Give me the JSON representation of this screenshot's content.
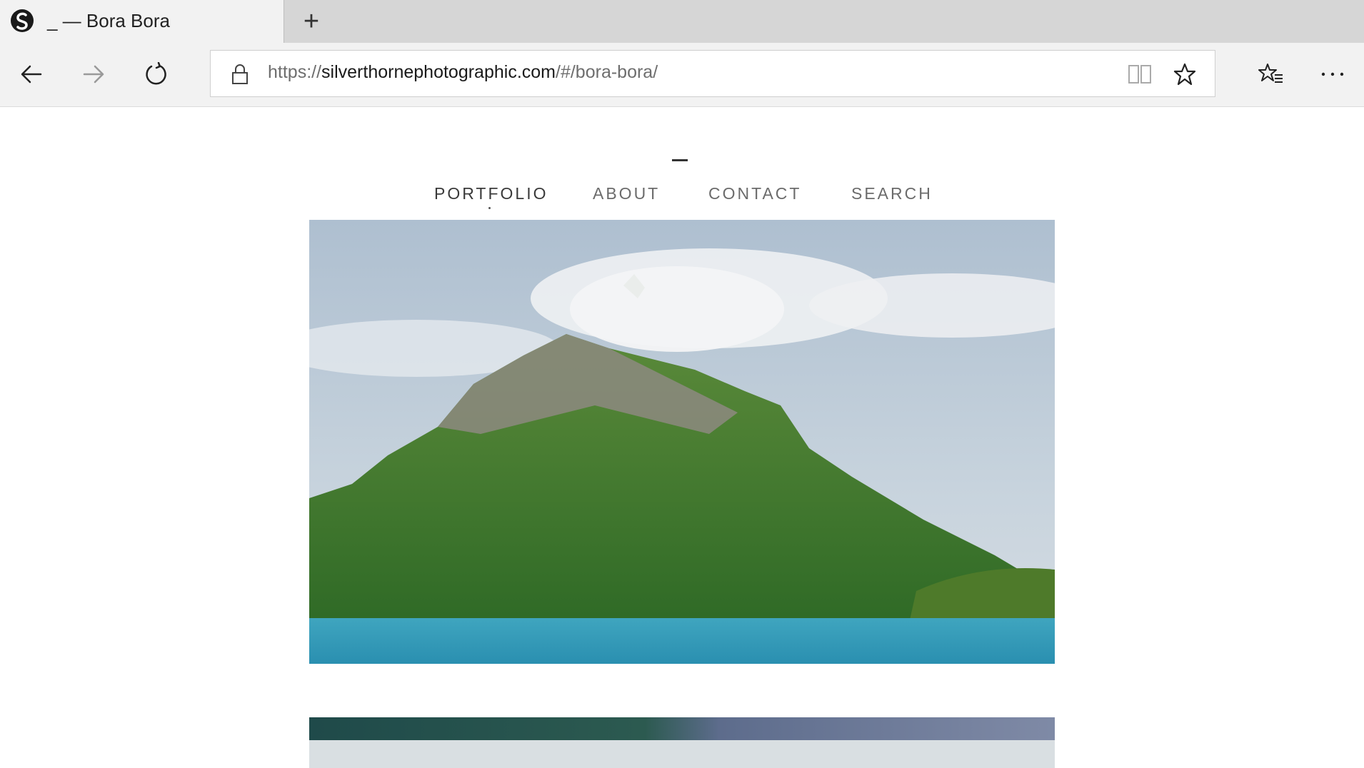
{
  "browser": {
    "tab_title": "_ — Bora Bora",
    "new_tab_label": "+",
    "url_scheme": "https://",
    "url_domain": "silverthornephotographic.com",
    "url_path": "/#/bora-bora/"
  },
  "site": {
    "nav": [
      {
        "label": "PORTFOLIO",
        "active": true
      },
      {
        "label": "ABOUT",
        "active": false
      },
      {
        "label": "CONTACT",
        "active": false
      },
      {
        "label": "SEARCH",
        "active": false
      }
    ]
  },
  "colors": {
    "tabstrip": "#d6d6d6",
    "toolbar": "#f2f2f2",
    "nav_text": "#6b6b6b",
    "nav_active": "#3a3a3a"
  }
}
